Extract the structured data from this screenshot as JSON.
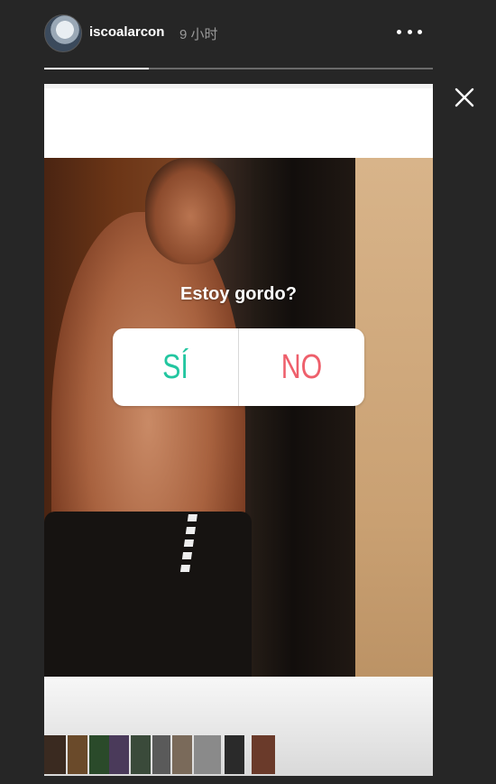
{
  "header": {
    "username": "iscoalarcon",
    "timestamp": "9 小时",
    "avatar_icon": "profile-avatar",
    "more_icon": "more-horizontal-icon"
  },
  "progress": {
    "fraction": 0.27
  },
  "close_icon": "close-icon",
  "poll": {
    "question": "Estoy gordo?",
    "option_yes": "SÍ",
    "option_no": "NO",
    "colors": {
      "yes": "#22c6a0",
      "no": "#ee5f6b"
    }
  },
  "thumbnails": [
    {
      "color": "#3a2a20"
    },
    {
      "color": "#6a4a2a"
    },
    {
      "color": "#2a4a2a"
    },
    {
      "color": "#4a3a5a"
    },
    {
      "color": "#3a4a3a"
    },
    {
      "color": "#5a5a5a"
    },
    {
      "color": "#7a6a5a"
    },
    {
      "color": "#8a8a8a"
    },
    {
      "color": "#2a2a2a"
    },
    {
      "color": "#6a3a2a"
    }
  ]
}
